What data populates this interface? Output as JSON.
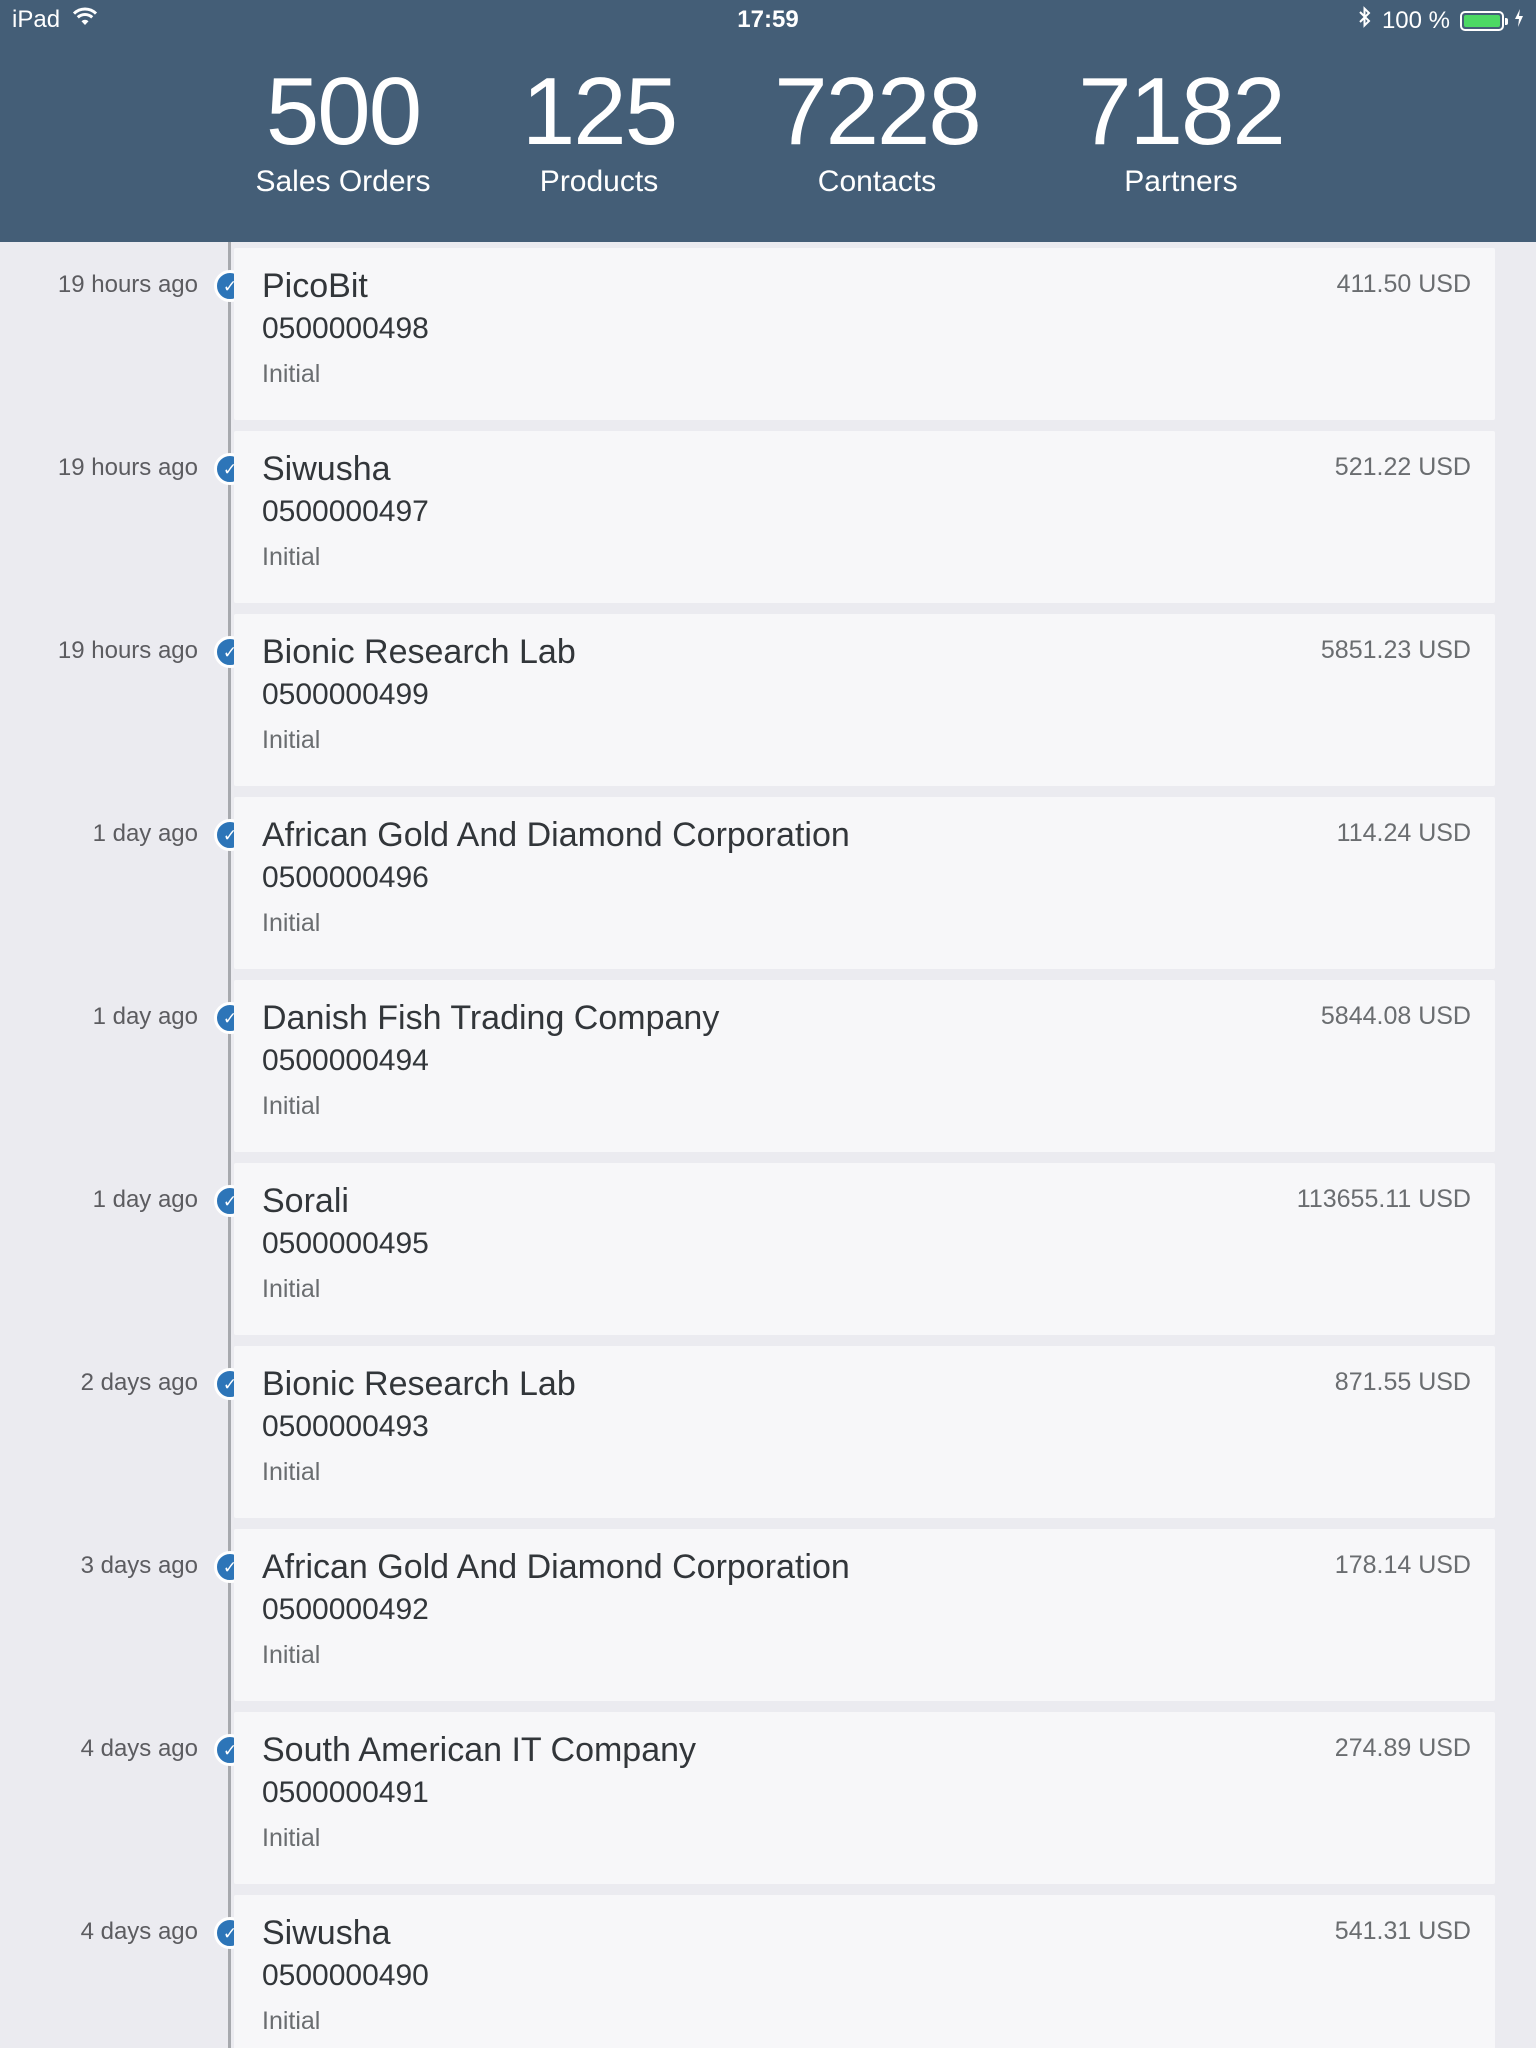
{
  "status_bar": {
    "device": "iPad",
    "time": "17:59",
    "battery_text": "100 %",
    "battery_level": 1.0,
    "battery_color": "#4cd964",
    "charging": true
  },
  "colors": {
    "header_bg": "#445e77",
    "accent": "#2d75b8",
    "timeline_line": "#a7a9ae"
  },
  "stats": [
    {
      "value": "500",
      "label": "Sales Orders"
    },
    {
      "value": "125",
      "label": "Products"
    },
    {
      "value": "7228",
      "label": "Contacts"
    },
    {
      "value": "7182",
      "label": "Partners"
    }
  ],
  "orders": [
    {
      "time": "19 hours ago",
      "name": "PicoBit",
      "number": "0500000498",
      "status": "Initial",
      "amount": "411.50 USD"
    },
    {
      "time": "19 hours ago",
      "name": "Siwusha",
      "number": "0500000497",
      "status": "Initial",
      "amount": "521.22 USD"
    },
    {
      "time": "19 hours ago",
      "name": "Bionic Research Lab",
      "number": "0500000499",
      "status": "Initial",
      "amount": "5851.23 USD"
    },
    {
      "time": "1 day ago",
      "name": "African Gold And Diamond Corporation",
      "number": "0500000496",
      "status": "Initial",
      "amount": "114.24 USD"
    },
    {
      "time": "1 day ago",
      "name": "Danish Fish Trading Company",
      "number": "0500000494",
      "status": "Initial",
      "amount": "5844.08 USD"
    },
    {
      "time": "1 day ago",
      "name": "Sorali",
      "number": "0500000495",
      "status": "Initial",
      "amount": "113655.11 USD"
    },
    {
      "time": "2 days ago",
      "name": "Bionic Research Lab",
      "number": "0500000493",
      "status": "Initial",
      "amount": "871.55 USD"
    },
    {
      "time": "3 days ago",
      "name": "African Gold And Diamond Corporation",
      "number": "0500000492",
      "status": "Initial",
      "amount": "178.14 USD"
    },
    {
      "time": "4 days ago",
      "name": "South American IT Company",
      "number": "0500000491",
      "status": "Initial",
      "amount": "274.89 USD"
    },
    {
      "time": "4 days ago",
      "name": "Siwusha",
      "number": "0500000490",
      "status": "Initial",
      "amount": "541.31 USD"
    }
  ]
}
